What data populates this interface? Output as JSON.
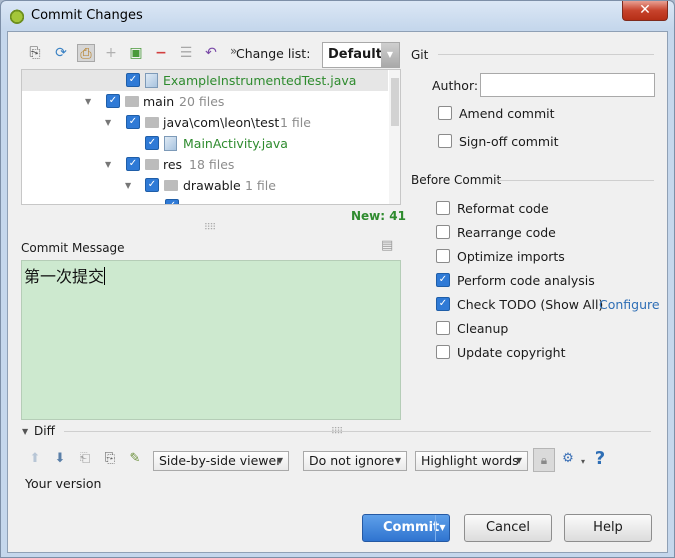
{
  "window": {
    "title": "Commit Changes",
    "close_glyph": "✕"
  },
  "toolbar": {
    "icons": [
      "refresh-local-icon",
      "refresh-icon",
      "diff-toggle-icon",
      "add-icon",
      "move-icon",
      "remove-icon",
      "group-icon",
      "revert-icon"
    ],
    "changelist_label": "Change list:",
    "changelist_value": "Default"
  },
  "tree": {
    "rows": [
      {
        "label": "ExampleInstrumentedTest.java",
        "meta": "",
        "type": "file"
      },
      {
        "label": "main",
        "meta": "20 files",
        "type": "folder"
      },
      {
        "label": "java\\com\\leon\\test",
        "meta": "1 file",
        "type": "folder"
      },
      {
        "label": "MainActivity.java",
        "meta": "",
        "type": "file"
      },
      {
        "label": "res",
        "meta": "18 files",
        "type": "folder"
      },
      {
        "label": "drawable",
        "meta": "1 file",
        "type": "folder"
      }
    ],
    "new_count": "New: 41"
  },
  "commit_message": {
    "label": "Commit Message",
    "text": "第一次提交"
  },
  "git": {
    "section_label": "Git",
    "author_label": "Author:",
    "author_value": "",
    "amend_label": "Amend commit",
    "signoff_label": "Sign-off commit"
  },
  "before_commit": {
    "section_label": "Before Commit",
    "options": [
      {
        "label": "Reformat code",
        "checked": false
      },
      {
        "label": "Rearrange code",
        "checked": false
      },
      {
        "label": "Optimize imports",
        "checked": false
      },
      {
        "label": "Perform code analysis",
        "checked": true
      },
      {
        "label": "Check TODO (Show All)",
        "checked": true
      },
      {
        "label": "Cleanup",
        "checked": false
      },
      {
        "label": "Update copyright",
        "checked": false
      }
    ],
    "configure_link": "Configure"
  },
  "diff": {
    "section_label": "Diff",
    "viewer": "Side-by-side viewer",
    "ignore": "Do not ignore",
    "highlight": "Highlight words",
    "your_version": "Your version",
    "help_glyph": "?"
  },
  "buttons": {
    "commit": "Commit",
    "cancel": "Cancel",
    "help": "Help"
  },
  "colors": {
    "message_bg": "#cde9cf",
    "accent": "#2f7ad6",
    "new_files": "#2e8b2e",
    "link": "#2e6eb5"
  }
}
